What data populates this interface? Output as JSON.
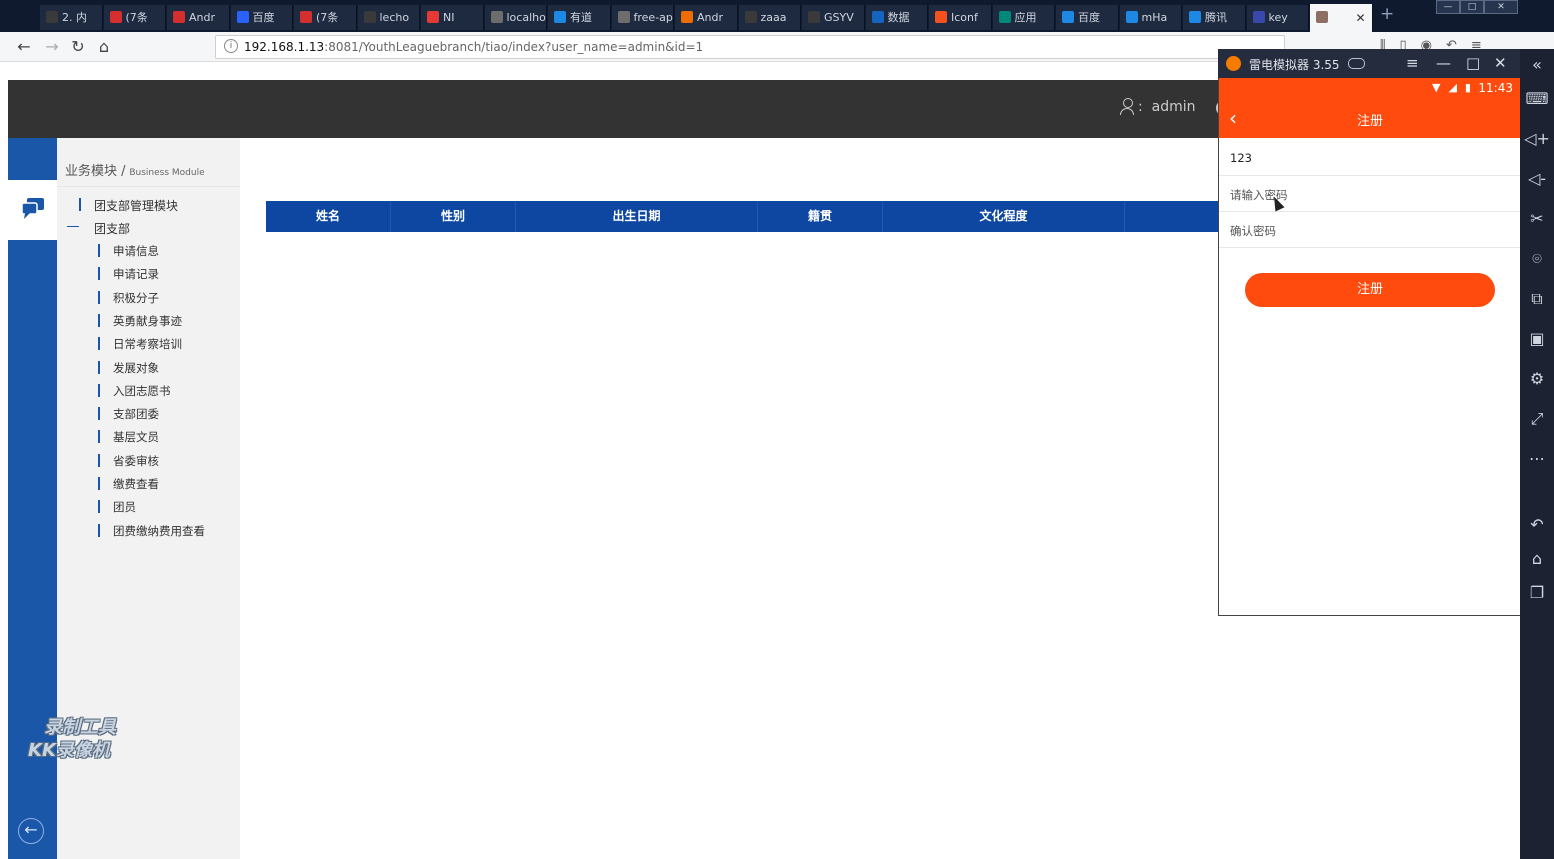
{
  "browser": {
    "tabs": [
      {
        "label": "2. 内",
        "color": "#3a3a3a"
      },
      {
        "label": "(7条",
        "color": "#d32f2f"
      },
      {
        "label": "Andr",
        "color": "#d32f2f"
      },
      {
        "label": "百度",
        "color": "#2962ff"
      },
      {
        "label": "(7条",
        "color": "#d32f2f"
      },
      {
        "label": "lecho",
        "color": "#3a3a3a"
      },
      {
        "label": "NI",
        "color": "#e53935"
      },
      {
        "label": "localhost",
        "color": "#6d6d6d"
      },
      {
        "label": "有道",
        "color": "#1e88e5"
      },
      {
        "label": "free-api.h",
        "color": "#6d6d6d"
      },
      {
        "label": "Andr",
        "color": "#ef6c00"
      },
      {
        "label": "zaaa",
        "color": "#3a3a3a"
      },
      {
        "label": "GSYV",
        "color": "#3a3a3a"
      },
      {
        "label": "数据",
        "color": "#1565c0"
      },
      {
        "label": "Iconf",
        "color": "#f4511e"
      },
      {
        "label": "应用",
        "color": "#00897b"
      },
      {
        "label": "百度",
        "color": "#1e88e5"
      },
      {
        "label": "mHa",
        "color": "#1e88e5"
      },
      {
        "label": "腾讯",
        "color": "#1e88e5"
      },
      {
        "label": "key",
        "color": "#3949ab"
      },
      {
        "label": "",
        "color": "#8d6e63",
        "active": true
      }
    ],
    "url_host": "192.168.1.13",
    "url_rest": ":8081/YouthLeaguebranch/tiao/index?user_name=admin&id=1"
  },
  "header": {
    "user_prefix": ":",
    "username": "admin"
  },
  "sidebar": {
    "title_zh": "业务模块 /",
    "title_en": "Business Module",
    "root_item": "团支部管理模块",
    "group_label": "团支部",
    "items": [
      "申请信息",
      "申请记录",
      "积极分子",
      "英勇献身事迹",
      "日常考察培训",
      "发展对象",
      "入团志愿书",
      "支部团委",
      "基层文员",
      "省委审核",
      "缴费查看",
      "团员",
      "团费缴纳费用查看"
    ]
  },
  "table": {
    "columns": [
      "姓名",
      "性别",
      "出生日期",
      "籍贯",
      "文化程度",
      ""
    ]
  },
  "watermark": {
    "line1": "录制工具",
    "line2": "KK录像机"
  },
  "emulator": {
    "title": "雷电模拟器 3.55",
    "time": "11:43",
    "app_title": "注册",
    "username_value": "123",
    "password_placeholder": "请输入密码",
    "confirm_placeholder": "确认密码",
    "register_label": "注册"
  },
  "colors": {
    "accent_blue": "#1a57a8",
    "table_header": "#0d47a1",
    "app_orange": "#ff4b0e",
    "header_dark": "#333333"
  }
}
